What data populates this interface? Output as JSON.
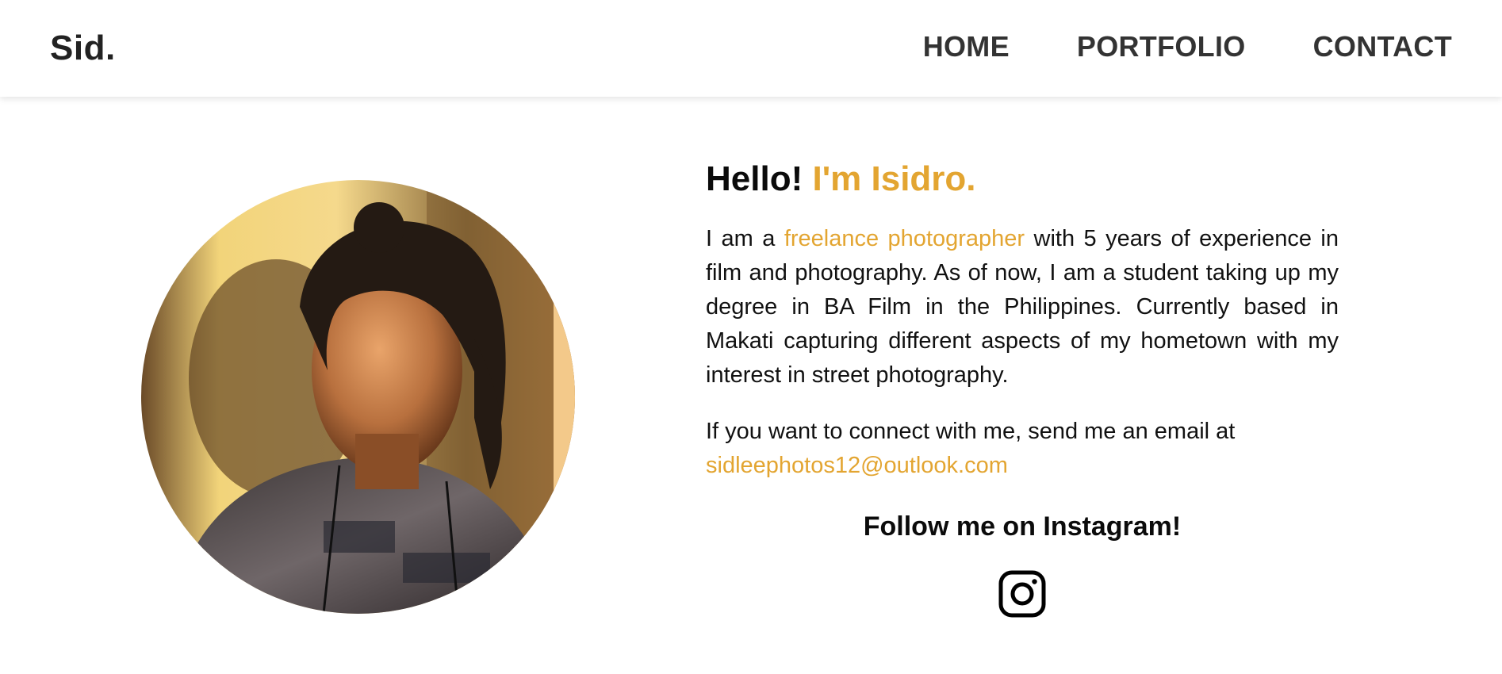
{
  "nav": {
    "brand": "Sid.",
    "links": [
      "HOME",
      "PORTFOLIO",
      "CONTACT"
    ]
  },
  "about": {
    "greeting_prefix": "Hello!",
    "greeting_name": "I'm Isidro.",
    "bio_before": "I am a ",
    "bio_highlight": "freelance photographer",
    "bio_after": " with 5 years of experience in film and photography. As of now, I am a student taking up my degree in BA Film in the Philippines. Currently based in Makati capturing different aspects of my hometown with my interest in street photography.",
    "contact_text": "If you want to connect with me, send me an email at",
    "email": "sidleephotos12@outlook.com",
    "follow_text": "Follow me on Instagram!"
  },
  "icons": {
    "social": "instagram-icon",
    "portrait": "profile-photo"
  },
  "colors": {
    "accent": "#e3a531",
    "text": "#111111",
    "nav_text": "#333333"
  }
}
